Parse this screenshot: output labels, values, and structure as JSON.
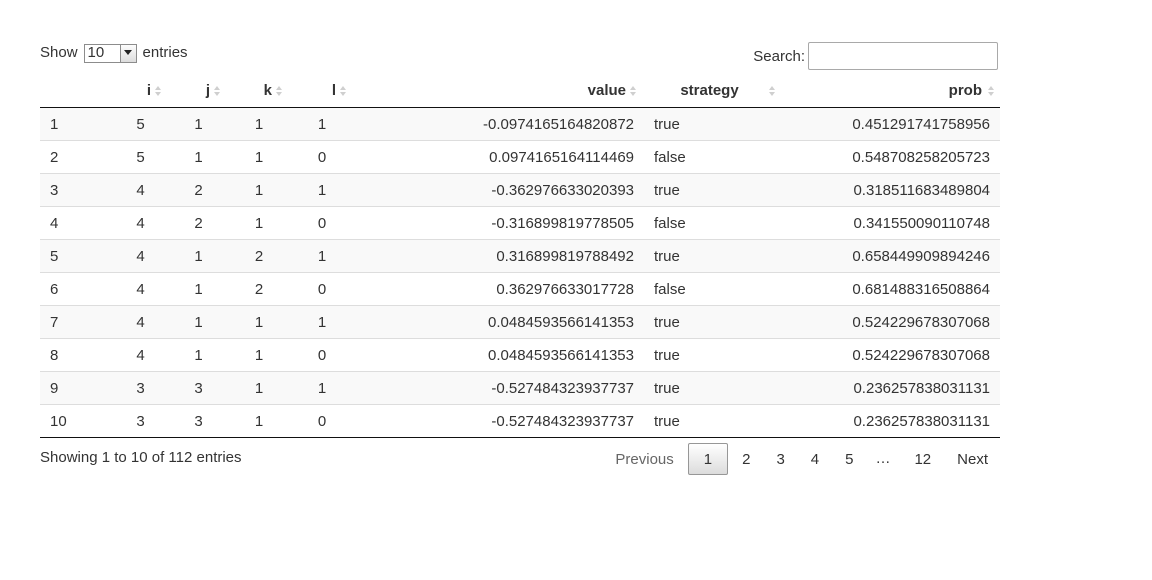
{
  "length": {
    "show_label": "Show",
    "selected": "10",
    "entries_label": "entries"
  },
  "search": {
    "label": "Search:",
    "value": ""
  },
  "table": {
    "headers": {
      "rownum": "",
      "i": "i",
      "j": "j",
      "k": "k",
      "l": "l",
      "value": "value",
      "strategy": "strategy",
      "prob": "prob"
    },
    "rows": [
      {
        "n": "1",
        "i": "5",
        "j": "1",
        "k": "1",
        "l": "1",
        "value": "-0.0974165164820872",
        "strategy": "true",
        "prob": "0.451291741758956"
      },
      {
        "n": "2",
        "i": "5",
        "j": "1",
        "k": "1",
        "l": "0",
        "value": "0.0974165164114469",
        "strategy": "false",
        "prob": "0.548708258205723"
      },
      {
        "n": "3",
        "i": "4",
        "j": "2",
        "k": "1",
        "l": "1",
        "value": "-0.362976633020393",
        "strategy": "true",
        "prob": "0.318511683489804"
      },
      {
        "n": "4",
        "i": "4",
        "j": "2",
        "k": "1",
        "l": "0",
        "value": "-0.316899819778505",
        "strategy": "false",
        "prob": "0.341550090110748"
      },
      {
        "n": "5",
        "i": "4",
        "j": "1",
        "k": "2",
        "l": "1",
        "value": "0.316899819788492",
        "strategy": "true",
        "prob": "0.658449909894246"
      },
      {
        "n": "6",
        "i": "4",
        "j": "1",
        "k": "2",
        "l": "0",
        "value": "0.362976633017728",
        "strategy": "false",
        "prob": "0.681488316508864"
      },
      {
        "n": "7",
        "i": "4",
        "j": "1",
        "k": "1",
        "l": "1",
        "value": "0.0484593566141353",
        "strategy": "true",
        "prob": "0.524229678307068"
      },
      {
        "n": "8",
        "i": "4",
        "j": "1",
        "k": "1",
        "l": "0",
        "value": "0.0484593566141353",
        "strategy": "true",
        "prob": "0.524229678307068"
      },
      {
        "n": "9",
        "i": "3",
        "j": "3",
        "k": "1",
        "l": "1",
        "value": "-0.527484323937737",
        "strategy": "true",
        "prob": "0.236257838031131"
      },
      {
        "n": "10",
        "i": "3",
        "j": "3",
        "k": "1",
        "l": "0",
        "value": "-0.527484323937737",
        "strategy": "true",
        "prob": "0.236257838031131"
      }
    ]
  },
  "info": {
    "text": "Showing 1 to 10 of 112 entries"
  },
  "pagination": {
    "previous": "Previous",
    "pages": [
      "1",
      "2",
      "3",
      "4",
      "5"
    ],
    "current": "1",
    "ellipsis": "…",
    "last": "12",
    "next": "Next"
  },
  "icons": {
    "sort": "sort-both-icon",
    "dropdown": "chevron-down-icon"
  }
}
